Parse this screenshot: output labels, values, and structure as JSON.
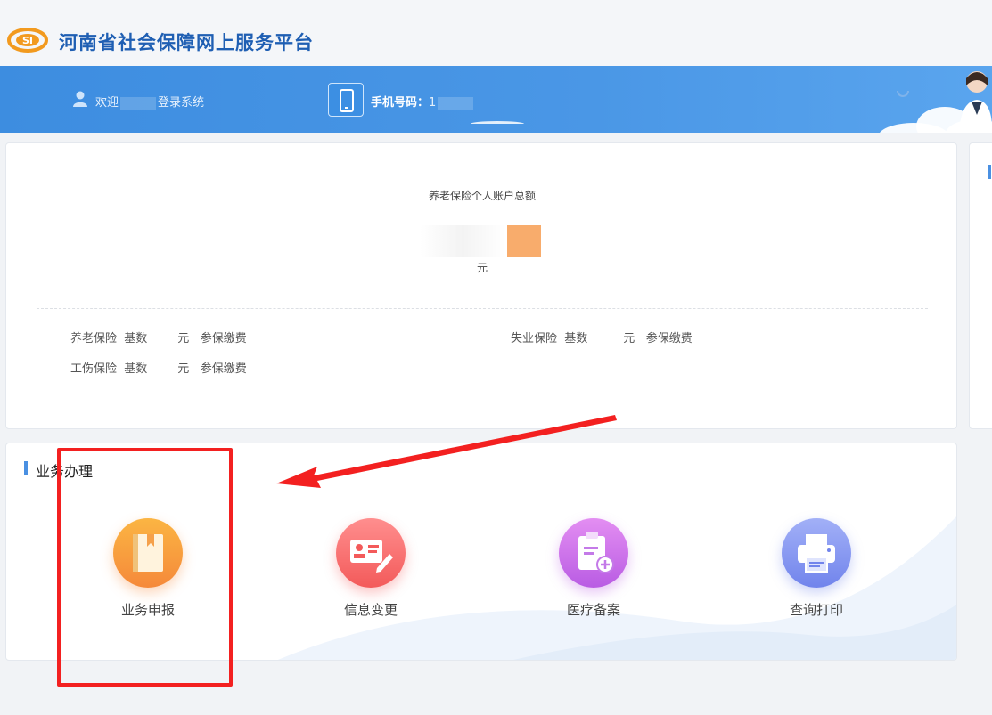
{
  "header": {
    "site_title": "河南省社会保障网上服务平台",
    "logo_text": "SI"
  },
  "bluebar": {
    "welcome_prefix": "欢迎",
    "welcome_suffix": "登录系统",
    "phone_label": "手机号码：",
    "phone_value": "1"
  },
  "account": {
    "title": "养老保险个人账户总额",
    "unit": "元",
    "rows": [
      {
        "name": "养老保险",
        "base_label": "基数",
        "unit": "元",
        "action": "参保缴费"
      },
      {
        "name": "失业保险",
        "base_label": "基数",
        "unit": "元",
        "action": "参保缴费"
      },
      {
        "name": "工伤保险",
        "base_label": "基数",
        "unit": "元",
        "action": "参保缴费"
      }
    ]
  },
  "business": {
    "title": "业务办理",
    "services": [
      {
        "label": "业务申报",
        "icon": "book-icon",
        "color_from": "#fbb543",
        "color_to": "#f5893a"
      },
      {
        "label": "信息变更",
        "icon": "id-card-edit-icon",
        "color_from": "#ff8e8e",
        "color_to": "#f35a5a"
      },
      {
        "label": "医疗备案",
        "icon": "clipboard-plus-icon",
        "color_from": "#e38ef2",
        "color_to": "#b95ce3"
      },
      {
        "label": "查询打印",
        "icon": "printer-icon",
        "color_from": "#a2b0f7",
        "color_to": "#7184ec"
      }
    ]
  },
  "colors": {
    "brand_blue": "#3d8de0",
    "annotation_red": "#f32020"
  }
}
